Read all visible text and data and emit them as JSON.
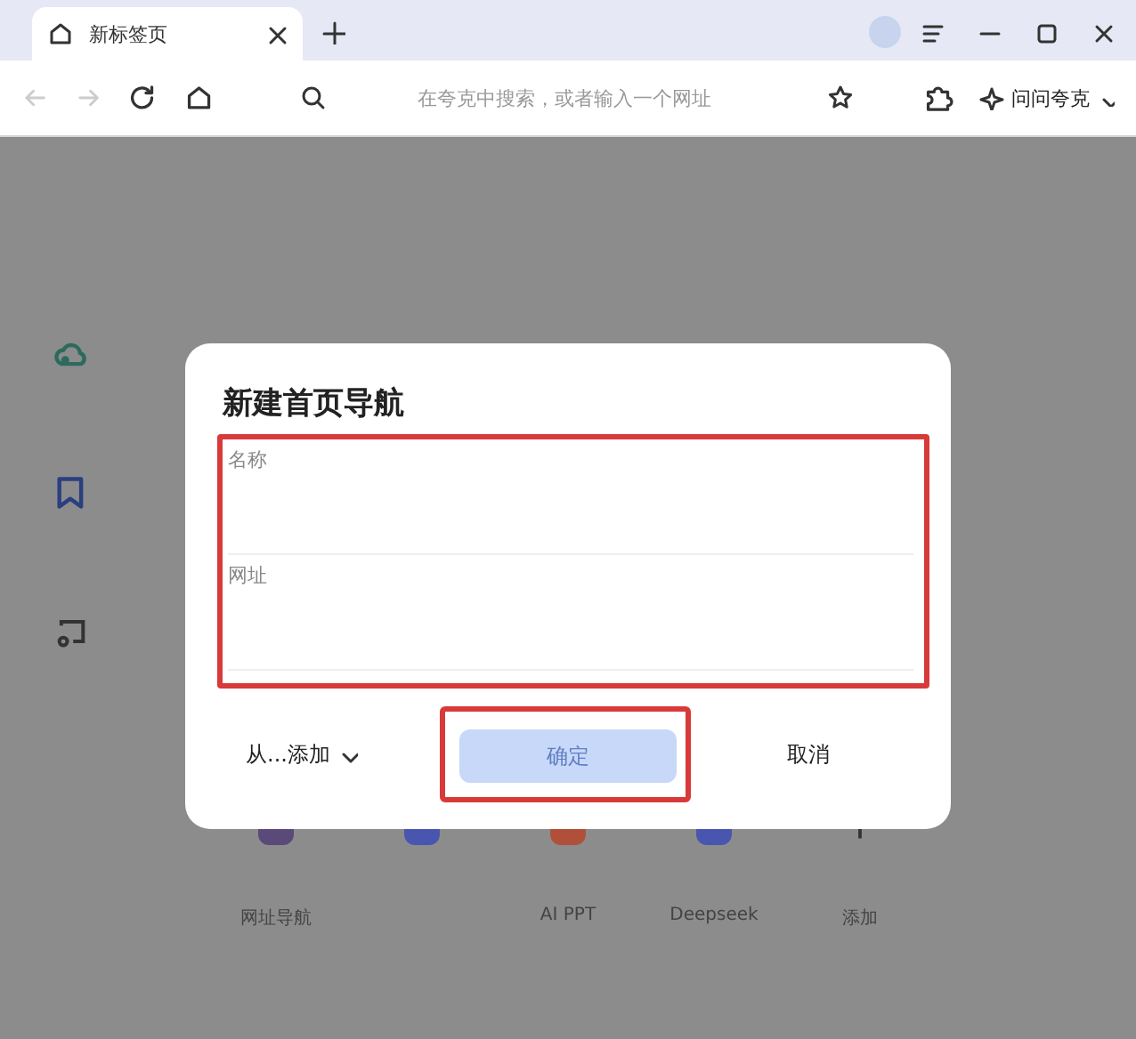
{
  "window": {
    "tabs": [
      {
        "label": "新标签页",
        "selected": true
      }
    ]
  },
  "toolbar": {
    "search": {
      "placeholder": "在夸克中搜索，或者输入一个网址"
    },
    "assistant": "问问夸克"
  },
  "page": {
    "shortcuts": [
      {
        "label": "网址导航",
        "color": "#5a4a7a"
      },
      {
        "color": "#4856b0"
      },
      {
        "label": "AI PPT",
        "color": "#b0503a"
      },
      {
        "label": "Deepseek",
        "color": "#4856b0"
      },
      {
        "label": "添加"
      }
    ]
  },
  "dialog": {
    "title": "新建首页导航",
    "fields": [
      {
        "label": "名称"
      },
      {
        "label": "网址"
      }
    ],
    "source": "从...添加",
    "confirm": {
      "label": "确定",
      "disabled": true
    },
    "cancel": "取消",
    "highlighted": true
  }
}
